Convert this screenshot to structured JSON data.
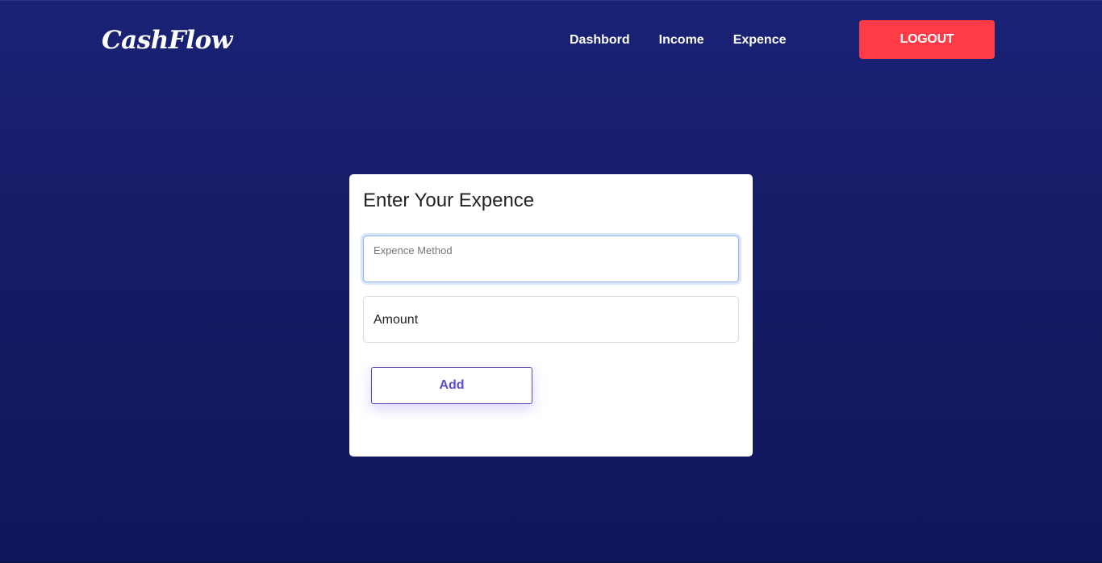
{
  "navbar": {
    "logo": "CashFlow",
    "links": [
      {
        "label": "Dashbord"
      },
      {
        "label": "Income"
      },
      {
        "label": "Expence"
      }
    ],
    "logout_label": "LOGOUT"
  },
  "form": {
    "title": "Enter Your Expence",
    "method_field": {
      "label": "Expence Method",
      "value": ""
    },
    "amount_field": {
      "placeholder": "Amount",
      "value": ""
    },
    "add_label": "Add"
  },
  "colors": {
    "background": "#141c66",
    "logout": "#ff3b47",
    "accent": "#5a4fc8"
  }
}
